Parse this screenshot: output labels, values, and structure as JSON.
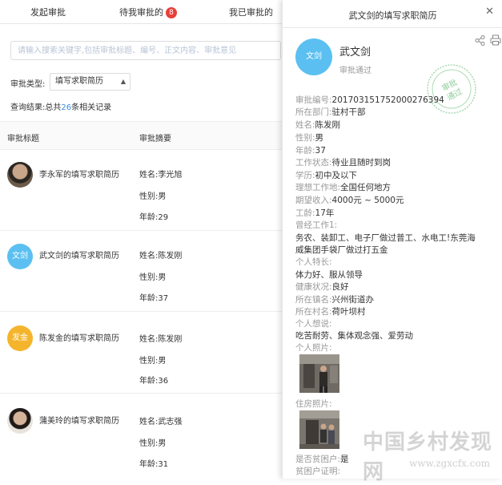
{
  "tabs": {
    "t1": "发起审批",
    "t2": "待我审批的",
    "t2_badge": "8",
    "t3": "我已审批的"
  },
  "search": {
    "placeholder": "请输入搜索关键字,包括审批标题、编号、正文内容、审批意见"
  },
  "filter": {
    "label": "审批类型:",
    "value": "填写求职简历"
  },
  "result": {
    "prefix": "查询结果:总共",
    "count": "26",
    "suffix": "条相关记录"
  },
  "table": {
    "col_title": "审批标题",
    "col_summary": "审批摘要",
    "rows": [
      {
        "avatar_text": "",
        "title": "李永军的填写求职简历",
        "name": "姓名:李光旭",
        "gender": "性别:男",
        "age": "年龄:29"
      },
      {
        "avatar_text": "文剑",
        "title": "武文剑的填写求职简历",
        "name": "姓名:陈发刚",
        "gender": "性别:男",
        "age": "年龄:37"
      },
      {
        "avatar_text": "发金",
        "title": "陈发金的填写求职简历",
        "name": "姓名:陈发刚",
        "gender": "性别:男",
        "age": "年龄:36"
      },
      {
        "avatar_text": "",
        "title": "蒲美玲的填写求职简历",
        "name": "姓名:武志强",
        "gender": "性别:男",
        "age": "年龄:31"
      }
    ]
  },
  "colors": {
    "badge": "#e8403a",
    "link": "#3a8ee6",
    "avatar_blue": "#5bc0f1",
    "avatar_orange": "#f4b52c",
    "stamp_green": "#7cc48a"
  },
  "detail": {
    "title": "武文剑的填写求职简历",
    "avatar_text": "文剑",
    "name": "武文剑",
    "status": "审批通过",
    "stamp": "审批通过",
    "fields": [
      {
        "k": "审批编号:",
        "v": "20170315175200027639​4"
      },
      {
        "k": "所在部门:",
        "v": "驻村干部"
      },
      {
        "k": "姓名:",
        "v": "陈发刚"
      },
      {
        "k": "性别:",
        "v": "男"
      },
      {
        "k": "年龄:",
        "v": "37"
      },
      {
        "k": "工作状态:",
        "v": "待业且随时到岗"
      },
      {
        "k": "学历:",
        "v": "初中及以下"
      },
      {
        "k": "理想工作地:",
        "v": "全国任何地方"
      },
      {
        "k": "期望收入:",
        "v": "4000元 ~ 5000元"
      },
      {
        "k": "工龄:",
        "v": "17年"
      }
    ],
    "work_label": "曾经工作1:",
    "work_line1": "务农、装卸工、电子厂做过普工、水电工!东莞海",
    "work_line2": "威集团手袋厂做过打五金",
    "skill_label": "个人特长:",
    "skill": "体力好、服从领导",
    "health_label": "健康状况:",
    "health": "良好",
    "town_label": "所在镇名:",
    "town": "兴州街道办",
    "village_label": "所在村名:",
    "village": "荷叶坝村",
    "say_label": "个人想说:",
    "say": "吃苦耐劳、集体观念强、爱劳动",
    "photo_label": "个人照片:",
    "house_label": "住房照片:",
    "poor_label": "是否贫困户:",
    "poor": "是",
    "proof_label": "贫困户证明:"
  },
  "watermark": {
    "main": "中国乡村发现网",
    "url": "www.zgxcfx.com"
  }
}
